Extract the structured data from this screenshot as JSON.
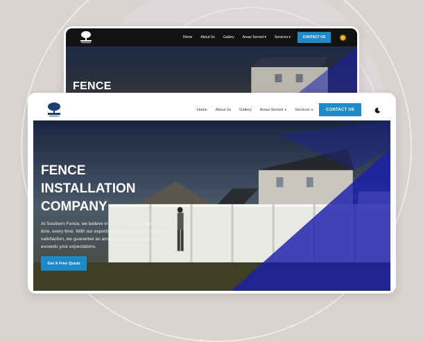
{
  "colors": {
    "page_background": "#d9d3d2",
    "accent": "#1e8ac8",
    "dark_nav": "#121212",
    "overlay_blue": "#1a1fa8"
  },
  "back_screen": {
    "theme": "dark",
    "nav": {
      "logo_icon": "tree-logo-icon",
      "links": [
        {
          "label": "Home",
          "dropdown": false
        },
        {
          "label": "About Us",
          "dropdown": false
        },
        {
          "label": "Gallery",
          "dropdown": false
        },
        {
          "label": "Areas Served",
          "dropdown": true
        },
        {
          "label": "Services",
          "dropdown": true
        }
      ],
      "cta": "CONTACT US",
      "theme_toggle_icon": "sun-icon"
    },
    "hero": {
      "title": "FENCE"
    }
  },
  "front_screen": {
    "theme": "light",
    "nav": {
      "logo_icon": "tree-logo-icon",
      "links": [
        {
          "label": "Home",
          "dropdown": false
        },
        {
          "label": "About Us",
          "dropdown": false
        },
        {
          "label": "Gallery",
          "dropdown": false
        },
        {
          "label": "Areas Served",
          "dropdown": true
        },
        {
          "label": "Services",
          "dropdown": true
        }
      ],
      "cta": "CONTACT US",
      "theme_toggle_icon": "moon-icon"
    },
    "hero": {
      "title_lines": [
        "FENCE",
        "INSTALLATION",
        "COMPANY"
      ],
      "description": "At Southern Fence, we believe in doing things right the first time, every time. With our expertise and dedication to customer satisfaction, we guarantee an amazing fencing experience that exceeds your expectations.",
      "button": "Get A Free Quote"
    }
  }
}
